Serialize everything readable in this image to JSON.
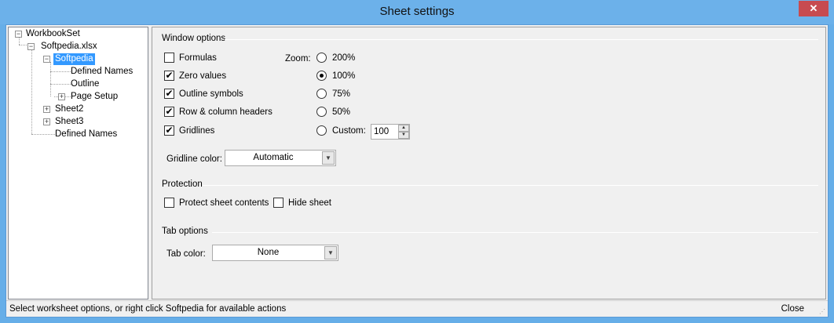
{
  "window": {
    "title": "Sheet settings",
    "close_glyph": "✕"
  },
  "tree": {
    "root": "WorkbookSet",
    "file": "Softpedia.xlsx",
    "sheet_selected": "Softpedia",
    "children": [
      "Defined Names",
      "Outline",
      "Page Setup"
    ],
    "sheet2": "Sheet2",
    "sheet3": "Sheet3",
    "defined_names_root": "Defined Names",
    "expander_minus": "−",
    "expander_plus": "+"
  },
  "window_options": {
    "title": "Window options",
    "checkboxes": [
      {
        "label": "Formulas",
        "checked": false
      },
      {
        "label": "Zero values",
        "checked": true
      },
      {
        "label": "Outline symbols",
        "checked": true
      },
      {
        "label": "Row & column headers",
        "checked": true
      },
      {
        "label": "Gridlines",
        "checked": true
      }
    ],
    "zoom_label": "Zoom:",
    "zoom_options": [
      {
        "label": "200%",
        "selected": false
      },
      {
        "label": "100%",
        "selected": true
      },
      {
        "label": "75%",
        "selected": false
      },
      {
        "label": "50%",
        "selected": false
      },
      {
        "label": "Custom:",
        "selected": false
      }
    ],
    "custom_zoom_value": "100",
    "gridline_color_label": "Gridline color:",
    "gridline_color_value": "Automatic"
  },
  "protection": {
    "title": "Protection",
    "protect_label": "Protect sheet contents",
    "protect_checked": false,
    "hide_label": "Hide sheet",
    "hide_checked": false
  },
  "tab_options": {
    "title": "Tab options",
    "tab_color_label": "Tab color:",
    "tab_color_value": "None"
  },
  "status": {
    "text": "Select worksheet options, or right click Softpedia for available actions",
    "close_label": "Close"
  },
  "icons": {
    "check": "✔",
    "combo_arrow": "▼",
    "spin_up": "▲",
    "spin_down": "▼",
    "grip": "⋰"
  }
}
